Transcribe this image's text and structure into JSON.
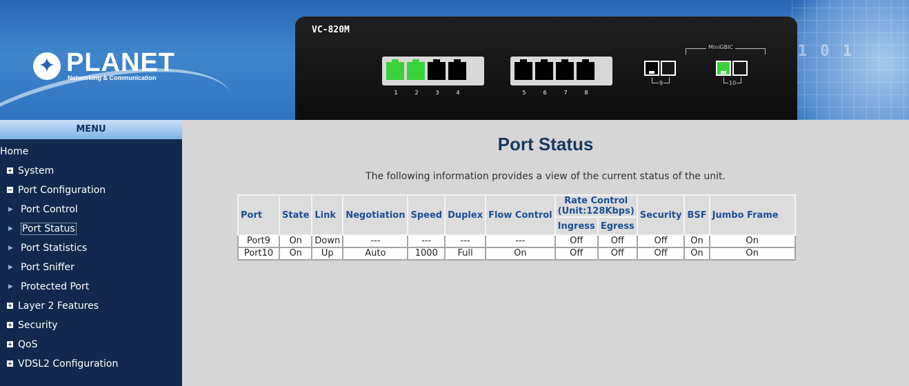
{
  "header": {
    "logo_name": "PLANET",
    "logo_subtitle": "Networking & Communication",
    "decor_digits": "0 1 0 1"
  },
  "device": {
    "model": "VC-820M",
    "minigbic_label": "MiniGBIC",
    "port_labels": [
      "1",
      "2",
      "3",
      "4",
      "5",
      "6",
      "7",
      "8"
    ],
    "sfp_labels": [
      "9",
      "10"
    ],
    "link_color": "#3ad23a"
  },
  "sidebar": {
    "title": "MENU",
    "items": [
      {
        "label": "Home",
        "level": 0,
        "icon": "none"
      },
      {
        "label": "System",
        "level": 1,
        "icon": "expand-plus-icon"
      },
      {
        "label": "Port Configuration",
        "level": 1,
        "icon": "collapse-minus-icon"
      },
      {
        "label": "Port Control",
        "level": 2,
        "icon": "arrow-right-icon"
      },
      {
        "label": "Port Status",
        "level": 2,
        "icon": "arrow-right-icon",
        "selected": true
      },
      {
        "label": "Port Statistics",
        "level": 2,
        "icon": "arrow-right-icon"
      },
      {
        "label": "Port Sniffer",
        "level": 2,
        "icon": "arrow-right-icon"
      },
      {
        "label": "Protected Port",
        "level": 2,
        "icon": "arrow-right-icon"
      },
      {
        "label": "Layer 2 Features",
        "level": 1,
        "icon": "expand-plus-icon"
      },
      {
        "label": "Security",
        "level": 1,
        "icon": "expand-plus-icon"
      },
      {
        "label": "QoS",
        "level": 1,
        "icon": "expand-plus-icon"
      },
      {
        "label": "VDSL2 Configuration",
        "level": 1,
        "icon": "expand-plus-icon"
      }
    ]
  },
  "main": {
    "title": "Port Status",
    "description": "The following information provides a view of the current status of the unit.",
    "table": {
      "headers": {
        "port": "Port",
        "state": "State",
        "link": "Link",
        "negotiation": "Negotiation",
        "speed": "Speed",
        "duplex": "Duplex",
        "flow_control": "Flow Control",
        "rate_control_line1": "Rate Control",
        "rate_control_line2": "(Unit:128Kbps)",
        "ingress": "Ingress",
        "egress": "Egress",
        "security": "Security",
        "bsf": "BSF",
        "jumbo_frame": "Jumbo Frame"
      },
      "rows": [
        [
          "Port9",
          "On",
          "Down",
          "---",
          "---",
          "---",
          "---",
          "Off",
          "Off",
          "Off",
          "On",
          "On"
        ],
        [
          "Port10",
          "On",
          "Up",
          "Auto",
          "1000",
          "Full",
          "On",
          "Off",
          "Off",
          "Off",
          "On",
          "On"
        ]
      ]
    }
  }
}
